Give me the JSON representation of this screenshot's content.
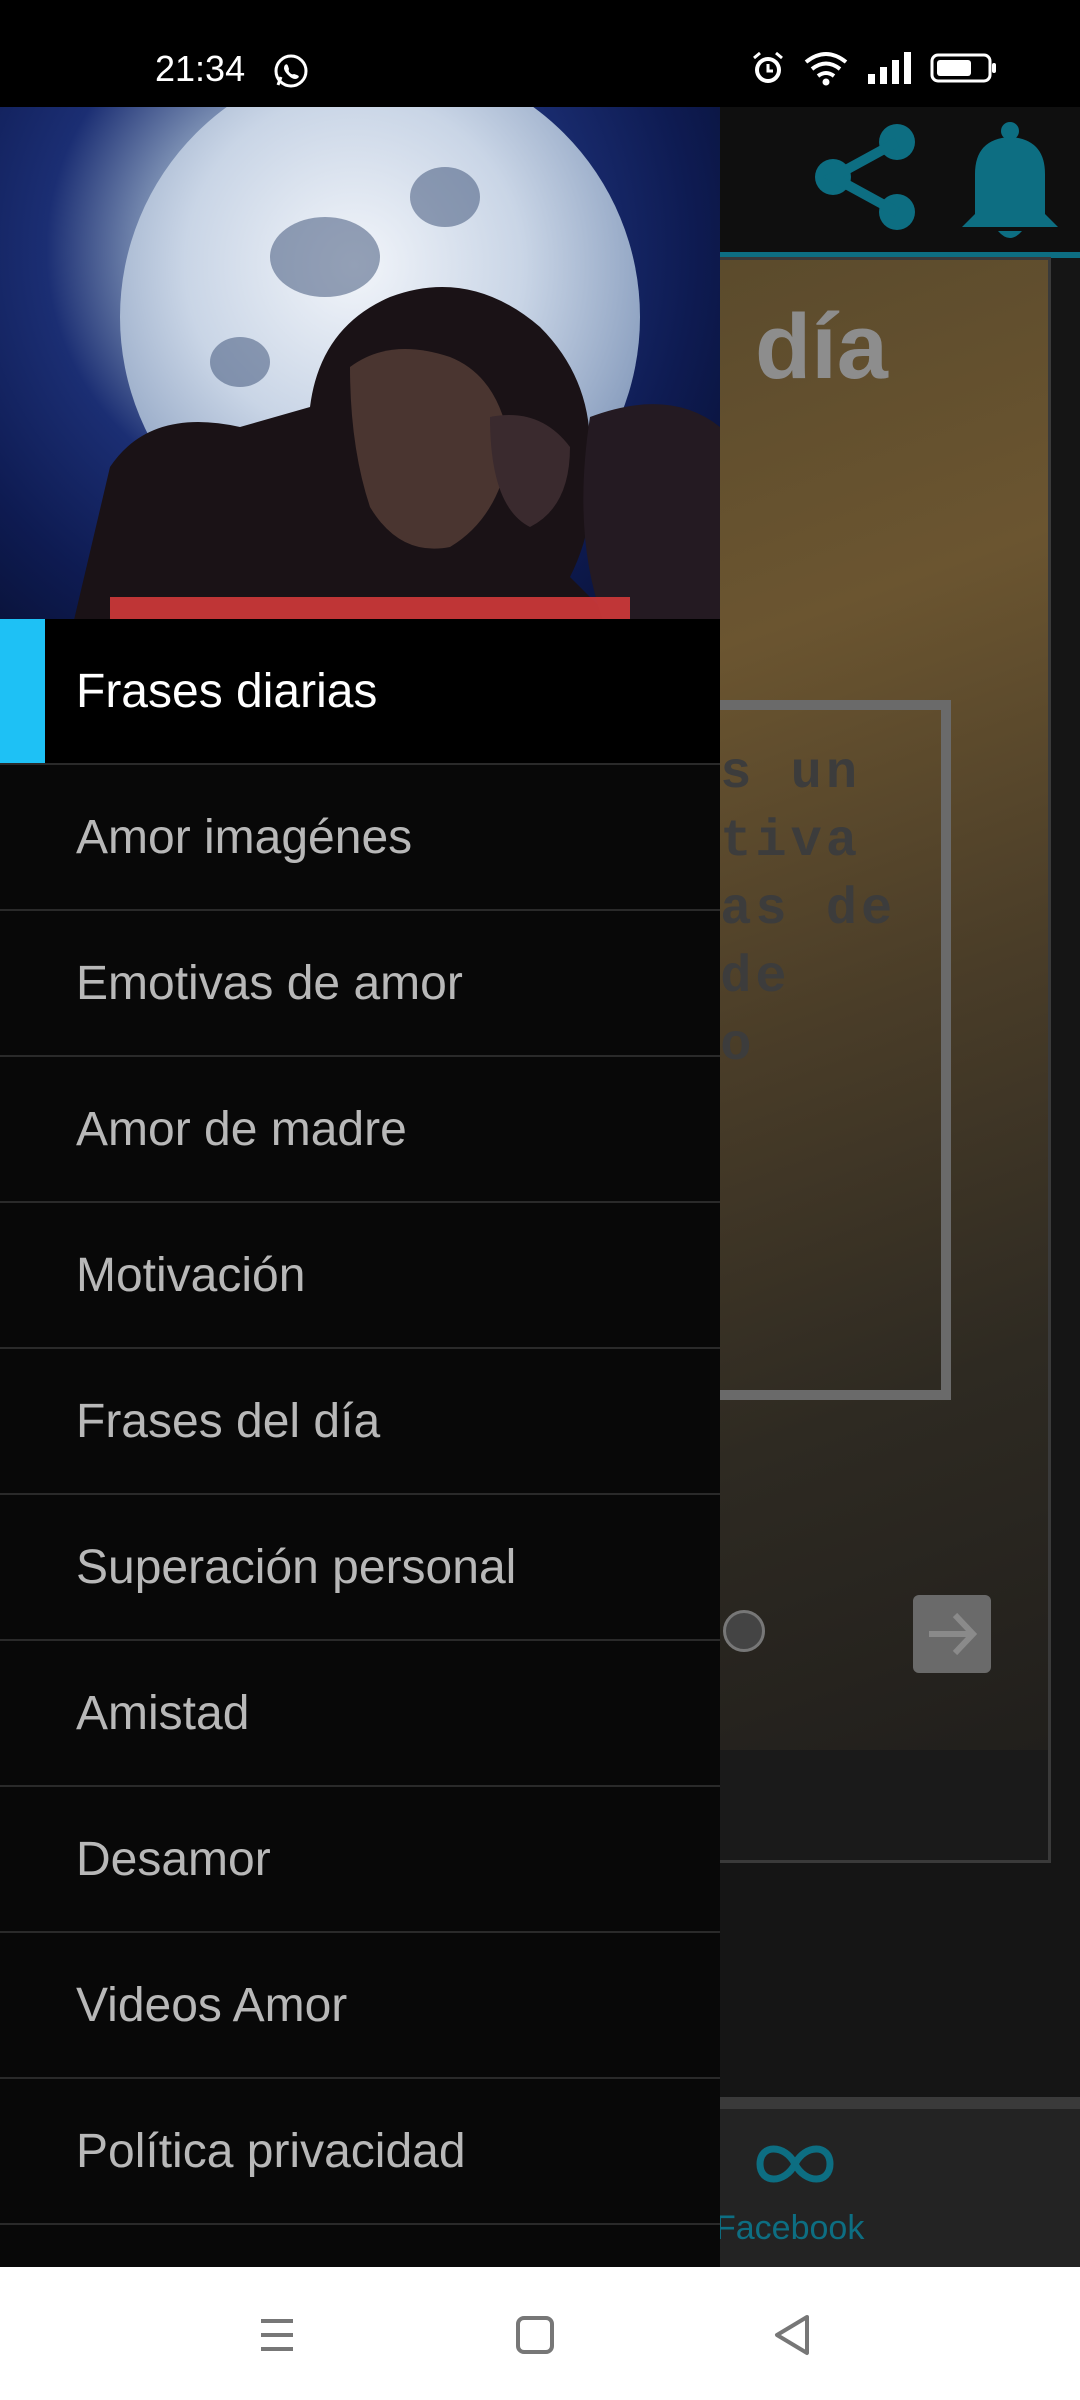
{
  "status_bar": {
    "time": "21:34",
    "icons": [
      "whatsapp-icon",
      "alarm-icon",
      "wifi-icon",
      "signal-icon",
      "battery-icon"
    ]
  },
  "background_app": {
    "card_title_fragment": "día",
    "quote_fragment": "es un\nltiva\nras de\n de\noo",
    "bottom_tab_label": "Facebook",
    "accent_color": "#0d6e82"
  },
  "drawer": {
    "header_image": "couple-moon-image",
    "menu_items": [
      {
        "label": "Frases diarias",
        "active": true
      },
      {
        "label": "Amor imagénes",
        "active": false
      },
      {
        "label": "Emotivas de amor",
        "active": false
      },
      {
        "label": "Amor de madre",
        "active": false
      },
      {
        "label": "Motivación",
        "active": false
      },
      {
        "label": "Frases del día",
        "active": false
      },
      {
        "label": "Superación personal",
        "active": false
      },
      {
        "label": "Amistad",
        "active": false
      },
      {
        "label": "Desamor",
        "active": false
      },
      {
        "label": "Videos Amor",
        "active": false
      },
      {
        "label": "Política privacidad",
        "active": false
      }
    ],
    "active_indicator_color": "#1ec1f5"
  },
  "nav_bar": {
    "buttons": [
      "menu-icon",
      "home-icon",
      "back-icon"
    ]
  }
}
